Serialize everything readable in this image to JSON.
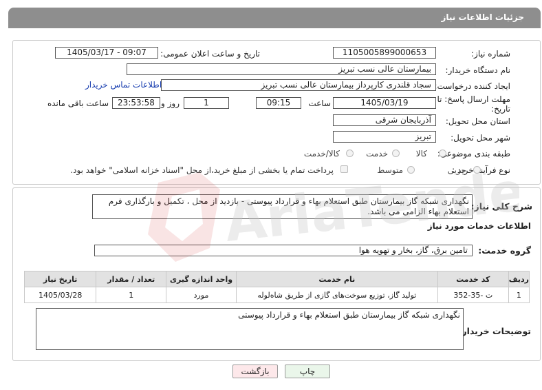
{
  "header": {
    "title": "جزئیات اطلاعات نیاز"
  },
  "form": {
    "need_number_label": "شماره نیاز:",
    "need_number": "1105005899000653",
    "announce_label": "تاریخ و ساعت اعلان عمومی:",
    "announce_value": "1405/03/17 - 09:07",
    "buyer_org_label": "نام دستگاه خریدار:",
    "buyer_org": "بیمارستان عالی نسب تبریز",
    "creator_label": "ایجاد کننده درخواست:",
    "creator": "سجاد قلندری کارپرداز بیمارستان عالی نسب تبریز",
    "contact_link": "اطلاعات تماس خریدار",
    "deadline_label_1": "مهلت ارسال پاسخ: تا",
    "deadline_label_2": "تاریخ:",
    "deadline_date": "1405/03/19",
    "time_label": "ساعت",
    "deadline_time": "09:15",
    "days_value": "1",
    "days_label": "روز و",
    "remaining_time": "23:53:58",
    "remaining_label": "ساعت باقی مانده",
    "province_label": "استان محل تحویل:",
    "province": "آذربایجان شرقی",
    "city_label": "شهر محل تحویل:",
    "city": "تبریز",
    "category_label": "طبقه بندی موضوعی:",
    "category_options": [
      "کالا",
      "خدمت",
      "کالا/خدمت"
    ],
    "process_label": "نوع فرآیند خرید :",
    "process_options": [
      "جزیی",
      "متوسط"
    ],
    "payment_note": "پرداخت تمام یا بخشی از مبلغ خرید،از محل \"اسناد خزانه اسلامی\" خواهد بود."
  },
  "summary": {
    "label": "شرح کلی نیاز:",
    "text": "نگهداری شبکه گاز بیمارستان طبق استعلام بهاء و قرارداد پیوستی - بازدید از محل ، تکمیل و بارگذاری فرم استعلام بهاء الزامی می باشد."
  },
  "services": {
    "section_title": "اطلاعات خدمات مورد نیاز",
    "group_label": "گروه خدمت:",
    "group_value": "تامین برق، گاز، بخار و تهویه هوا",
    "columns": [
      "ردیف",
      "کد خدمت",
      "نام خدمت",
      "واحد اندازه گیری",
      "تعداد / مقدار",
      "تاریخ نیاز"
    ],
    "rows": [
      [
        "1",
        "ت -35-352",
        "تولید گاز، توزیع سوخت‌های گازی از طریق شاه‌لوله",
        "مورد",
        "1",
        "1405/03/28"
      ]
    ]
  },
  "buyer_notes": {
    "label": "توضیحات خریدار:",
    "text": "نگهداری شبکه گاز بیمارستان طبق استعلام بهاء و قرارداد پیوستی"
  },
  "buttons": {
    "print": "چاپ",
    "back": "بازگشت"
  },
  "watermark": {
    "text": "AriaTender.net"
  },
  "colors": {
    "header_bg": "#8e8e8e",
    "link": "#1a3fb0",
    "table_header": "#e2e2e2",
    "back_button": "#fde8ea",
    "print_button": "#eaf6ea"
  }
}
